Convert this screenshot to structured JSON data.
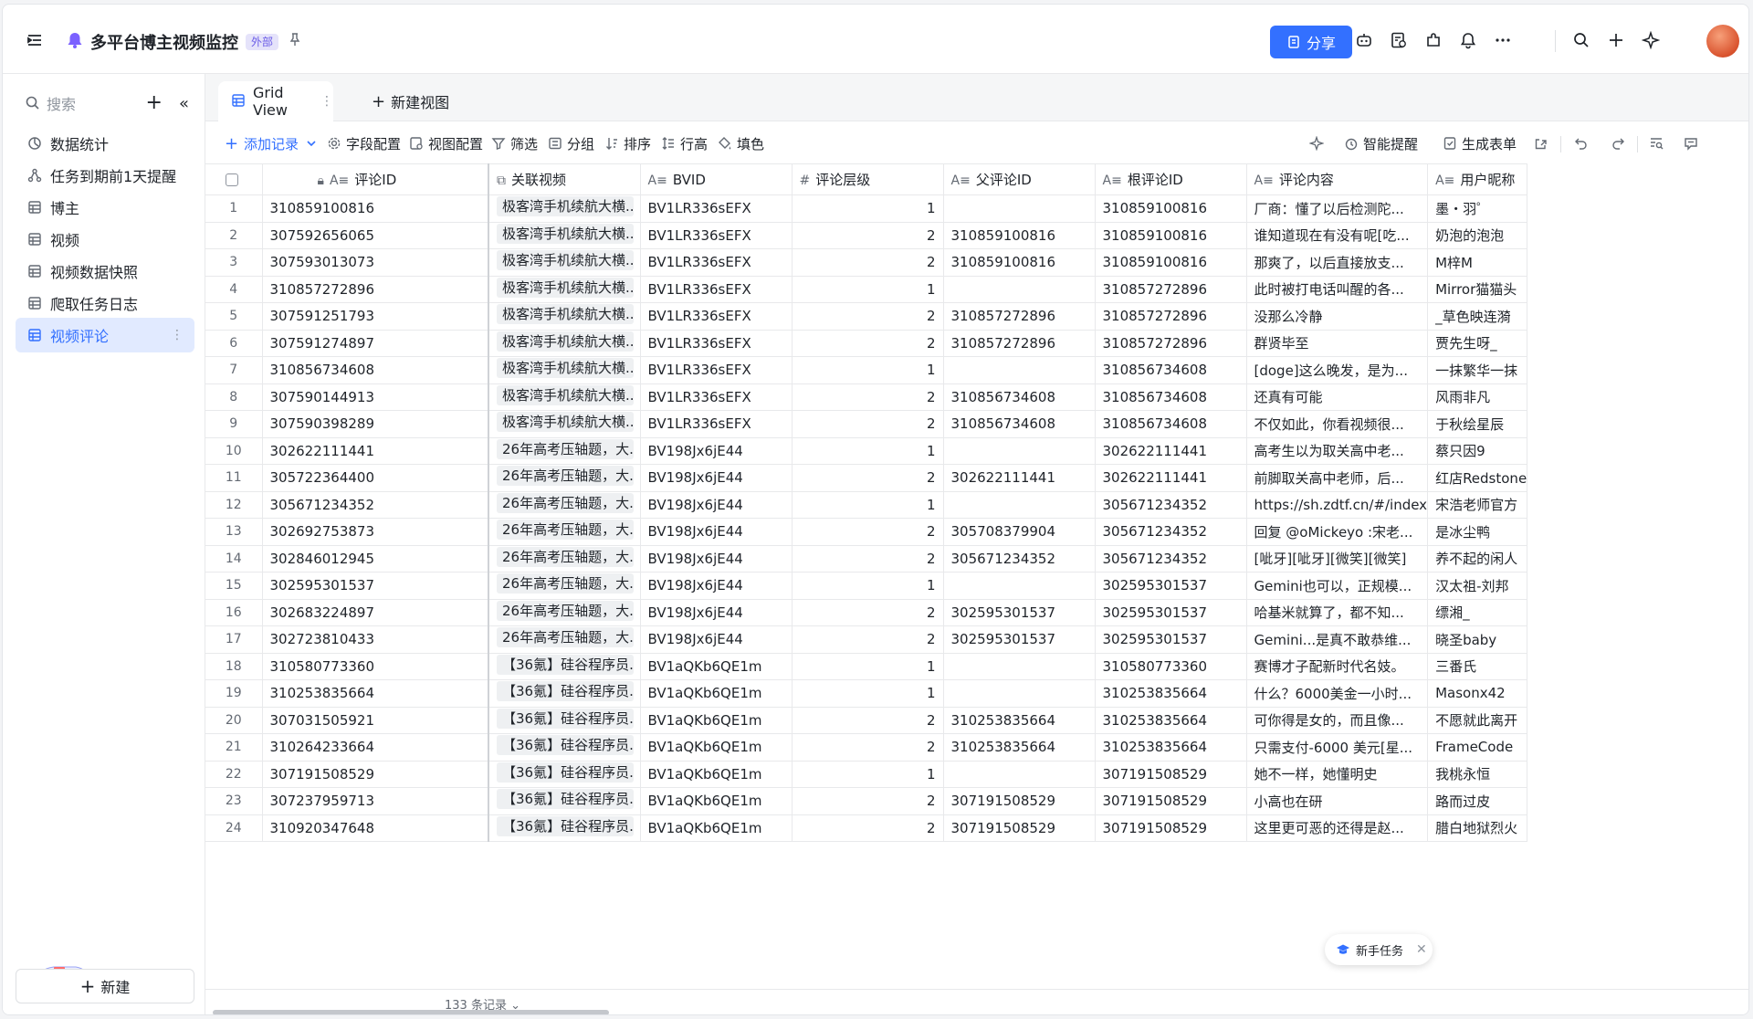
{
  "header": {
    "title": "多平台博主视频监控",
    "badge": "外部",
    "share_label": "分享"
  },
  "sidebar": {
    "search_placeholder": "搜索",
    "items": [
      {
        "label": "数据统计",
        "icon": "dashboard-icon"
      },
      {
        "label": "任务到期前1天提醒",
        "icon": "workflow-icon"
      },
      {
        "label": "博主",
        "icon": "table-icon"
      },
      {
        "label": "视频",
        "icon": "table-icon"
      },
      {
        "label": "视频数据快照",
        "icon": "table-icon"
      },
      {
        "label": "爬取任务日志",
        "icon": "table-icon"
      },
      {
        "label": "视频评论",
        "icon": "table-icon",
        "active": true
      }
    ],
    "new_label": "新建"
  },
  "tabs": {
    "active_label": "Grid View",
    "new_view_label": "新建视图"
  },
  "toolbar": {
    "add_record": "添加记录",
    "field_config": "字段配置",
    "view_config": "视图配置",
    "filter": "筛选",
    "group": "分组",
    "sort": "排序",
    "row_height": "行高",
    "fill_color": "填色",
    "smart_reminder": "智能提醒",
    "generate_form": "生成表单"
  },
  "grid": {
    "columns": [
      "评论ID",
      "关联视频",
      "BVID",
      "评论层级",
      "父评论ID",
      "根评论ID",
      "评论内容",
      "用户昵称"
    ],
    "rows": [
      [
        "1",
        "310859100816",
        "极客湾手机续航大横...",
        "BV1LR336sEFX",
        "1",
        "",
        "310859100816",
        "厂商：懂了以后检测陀...",
        "墨・羽゜"
      ],
      [
        "2",
        "307592656065",
        "极客湾手机续航大横...",
        "BV1LR336sEFX",
        "2",
        "310859100816",
        "310859100816",
        "谁知道现在有没有呢[吃...",
        "奶泡的泡泡"
      ],
      [
        "3",
        "307593013073",
        "极客湾手机续航大横...",
        "BV1LR336sEFX",
        "2",
        "310859100816",
        "310859100816",
        "那爽了，以后直接放支...",
        "M梓M"
      ],
      [
        "4",
        "310857272896",
        "极客湾手机续航大横...",
        "BV1LR336sEFX",
        "1",
        "",
        "310857272896",
        "此时被打电话叫醒的各...",
        "Mirror猫猫头"
      ],
      [
        "5",
        "307591251793",
        "极客湾手机续航大横...",
        "BV1LR336sEFX",
        "2",
        "310857272896",
        "310857272896",
        "没那么冷静",
        "_草色映连漪"
      ],
      [
        "6",
        "307591274897",
        "极客湾手机续航大横...",
        "BV1LR336sEFX",
        "2",
        "310857272896",
        "310857272896",
        "群贤毕至",
        "贾先生呀_"
      ],
      [
        "7",
        "310856734608",
        "极客湾手机续航大横...",
        "BV1LR336sEFX",
        "1",
        "",
        "310856734608",
        "[doge]这么晚发，是为...",
        "一抹繁华一抹"
      ],
      [
        "8",
        "307590144913",
        "极客湾手机续航大横...",
        "BV1LR336sEFX",
        "2",
        "310856734608",
        "310856734608",
        "还真有可能",
        "风雨非凡"
      ],
      [
        "9",
        "307590398289",
        "极客湾手机续航大横...",
        "BV1LR336sEFX",
        "2",
        "310856734608",
        "310856734608",
        "不仅如此，你看视频很...",
        "于秋绘星辰"
      ],
      [
        "10",
        "302622111441",
        "26年高考压轴题，大...",
        "BV198Jx6jE44",
        "1",
        "",
        "302622111441",
        "高考生以为取关高中老...",
        "蔡只因9"
      ],
      [
        "11",
        "305722364400",
        "26年高考压轴题，大...",
        "BV198Jx6jE44",
        "2",
        "302622111441",
        "302622111441",
        "前脚取关高中老师，后...",
        "红店Redstone"
      ],
      [
        "12",
        "305671234352",
        "26年高考压轴题，大...",
        "BV198Jx6jE44",
        "1",
        "",
        "305671234352",
        "https://sh.zdtf.cn/#/index",
        "宋浩老师官方"
      ],
      [
        "13",
        "302692753873",
        "26年高考压轴题，大...",
        "BV198Jx6jE44",
        "2",
        "305708379904",
        "305671234352",
        "回复 @oMickeyo :宋老...",
        "是冰尘鸭"
      ],
      [
        "14",
        "302846012945",
        "26年高考压轴题，大...",
        "BV198Jx6jE44",
        "2",
        "305671234352",
        "305671234352",
        "[呲牙][呲牙][微笑][微笑]",
        "养不起的闲人"
      ],
      [
        "15",
        "302595301537",
        "26年高考压轴题，大...",
        "BV198Jx6jE44",
        "1",
        "",
        "302595301537",
        "Gemini也可以，正规模...",
        "汉太祖-刘邦"
      ],
      [
        "16",
        "302683224897",
        "26年高考压轴题，大...",
        "BV198Jx6jE44",
        "2",
        "302595301537",
        "302595301537",
        "哈基米就算了，都不知...",
        "缥湘_"
      ],
      [
        "17",
        "302723810433",
        "26年高考压轴题，大...",
        "BV198Jx6jE44",
        "2",
        "302595301537",
        "302595301537",
        "Gemini...是真不敢恭维...",
        "晓圣baby"
      ],
      [
        "18",
        "310580773360",
        "【36氪】硅谷程序员...",
        "BV1aQKb6QE1m",
        "1",
        "",
        "310580773360",
        "赛博才子配新时代名妓。",
        "三番氏"
      ],
      [
        "19",
        "310253835664",
        "【36氪】硅谷程序员...",
        "BV1aQKb6QE1m",
        "1",
        "",
        "310253835664",
        "什么？6000美金一小时...",
        "Masonx42"
      ],
      [
        "20",
        "307031505921",
        "【36氪】硅谷程序员...",
        "BV1aQKb6QE1m",
        "2",
        "310253835664",
        "310253835664",
        "可你得是女的，而且像...",
        "不愿就此离开"
      ],
      [
        "21",
        "310264233664",
        "【36氪】硅谷程序员...",
        "BV1aQKb6QE1m",
        "2",
        "310253835664",
        "310253835664",
        "只需支付-6000 美元[星...",
        "FrameCode"
      ],
      [
        "22",
        "307191508529",
        "【36氪】硅谷程序员...",
        "BV1aQKb6QE1m",
        "1",
        "",
        "307191508529",
        "她不一样，她懂明史",
        "我桃永恒"
      ],
      [
        "23",
        "307237959713",
        "【36氪】硅谷程序员...",
        "BV1aQKb6QE1m",
        "2",
        "307191508529",
        "307191508529",
        "小高也在研",
        "路而过皮"
      ],
      [
        "24",
        "310920347648",
        "【36氪】硅谷程序员...",
        "BV1aQKb6QE1m",
        "2",
        "307191508529",
        "307191508529",
        "这里更可恶的还得是赵...",
        "腊白地狱烈火"
      ]
    ],
    "record_count": "133 条记录"
  },
  "toast": {
    "label": "新手任务"
  },
  "colors": {
    "accent": "#3370ff",
    "active_bg": "#e1eaff",
    "badge_bg": "#e5e3fa",
    "badge_fg": "#6b5ce7"
  }
}
